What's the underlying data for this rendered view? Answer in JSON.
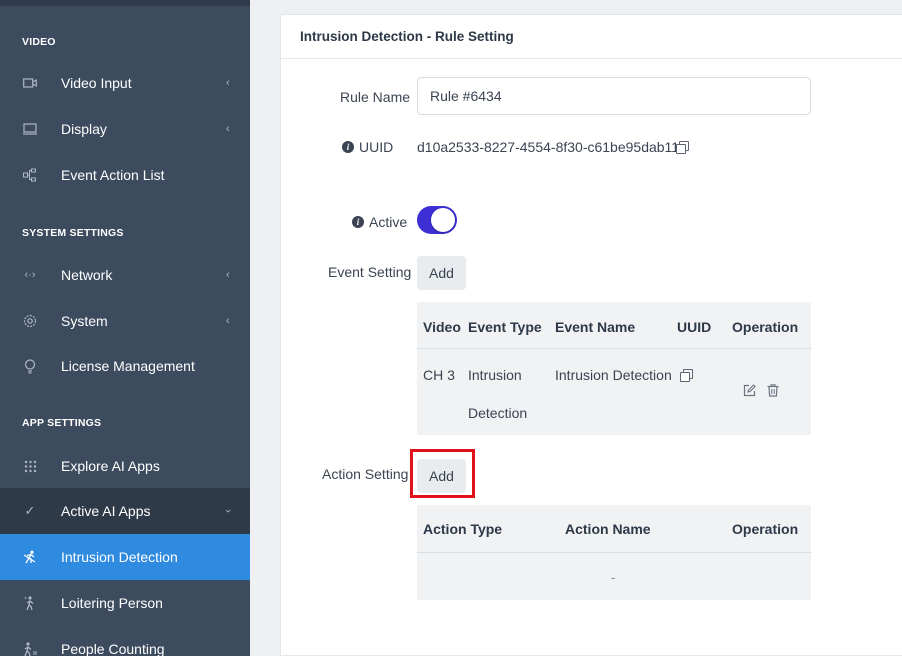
{
  "sidebar": {
    "sections": {
      "video": "VIDEO",
      "system": "SYSTEM SETTINGS",
      "app": "APP SETTINGS"
    },
    "items": [
      {
        "label": "Video Input",
        "icon": "video-camera-icon",
        "chevron": "‹"
      },
      {
        "label": "Display",
        "icon": "monitor-icon",
        "chevron": "‹"
      },
      {
        "label": "Event Action List",
        "icon": "hierarchy-icon",
        "chevron": ""
      },
      {
        "label": "Network",
        "icon": "network-arrows-icon",
        "chevron": "‹"
      },
      {
        "label": "System",
        "icon": "gear-icon",
        "chevron": "‹"
      },
      {
        "label": "License Management",
        "icon": "lightbulb-icon",
        "chevron": ""
      },
      {
        "label": "Explore AI Apps",
        "icon": "apps-grid-icon",
        "chevron": ""
      },
      {
        "label": "Active AI Apps",
        "icon": "check-icon",
        "chevron": "›"
      },
      {
        "label": "Intrusion Detection",
        "icon": "intrusion-person-icon",
        "chevron": ""
      },
      {
        "label": "Loitering Person",
        "icon": "walking-person-icon",
        "chevron": ""
      },
      {
        "label": "People Counting",
        "icon": "people-counting-icon",
        "chevron": ""
      }
    ],
    "active_item": "Intrusion Detection",
    "active_color": "#2f8be0"
  },
  "panel": {
    "title": "Intrusion Detection - Rule Setting"
  },
  "form": {
    "rule_name_label": "Rule Name",
    "rule_name_value": "Rule #6434",
    "uuid_label": "UUID",
    "uuid_value": "d10a2533-8227-4554-8f30-c61be95dab11",
    "active_label": "Active",
    "active_on": true,
    "toggle_color": "#3d2fd4",
    "event_setting_label": "Event Setting",
    "event_add_label": "Add",
    "action_setting_label": "Action Setting",
    "action_add_label": "Add"
  },
  "event_table": {
    "headers": [
      "Video",
      "Event Type",
      "Event Name",
      "UUID",
      "Operation"
    ],
    "rows": [
      {
        "video": "CH 3",
        "event_type_line1": "Intrusion",
        "event_type_line2": "Detection",
        "event_name": "Intrusion Detection"
      }
    ]
  },
  "action_table": {
    "headers": [
      "Action Type",
      "Action Name",
      "Operation"
    ],
    "empty_text": "-"
  },
  "highlight_color": "#e0111b"
}
